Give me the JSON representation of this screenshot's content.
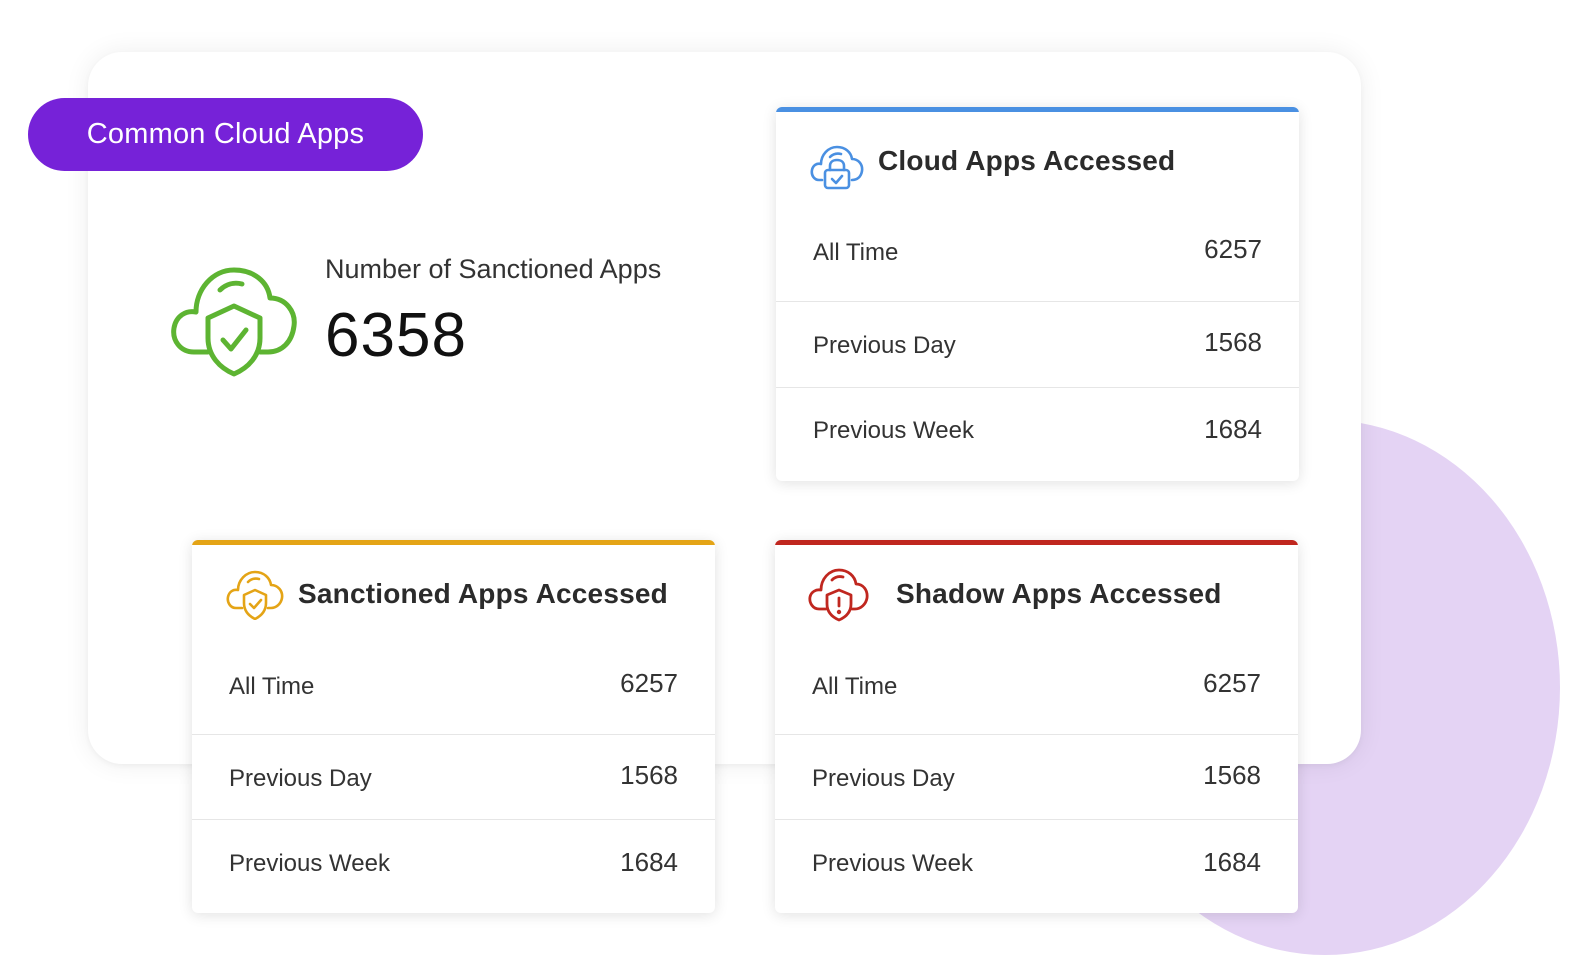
{
  "badge": {
    "label": "Common Cloud Apps"
  },
  "sanctioned_count": {
    "label": "Number of Sanctioned Apps",
    "value": "6358",
    "icon": "shield-cloud-icon",
    "color": "#5db432"
  },
  "cards": {
    "cloud": {
      "title": "Cloud Apps Accessed",
      "accent": "#4a90e2",
      "icon": "cloud-lock-icon",
      "rows": [
        {
          "label": "All Time",
          "value": "6257"
        },
        {
          "label": "Previous Day",
          "value": "1568"
        },
        {
          "label": "Previous Week",
          "value": "1684"
        }
      ]
    },
    "sanctioned": {
      "title": "Sanctioned Apps Accessed",
      "accent": "#e4a416",
      "icon": "cloud-shield-check-icon",
      "rows": [
        {
          "label": "All Time",
          "value": "6257"
        },
        {
          "label": "Previous Day",
          "value": "1568"
        },
        {
          "label": "Previous Week",
          "value": "1684"
        }
      ]
    },
    "shadow": {
      "title": "Shadow Apps Accessed",
      "accent": "#c0271f",
      "icon": "cloud-shield-alert-icon",
      "rows": [
        {
          "label": "All Time",
          "value": "6257"
        },
        {
          "label": "Previous Day",
          "value": "1568"
        },
        {
          "label": "Previous Week",
          "value": "1684"
        }
      ]
    }
  }
}
